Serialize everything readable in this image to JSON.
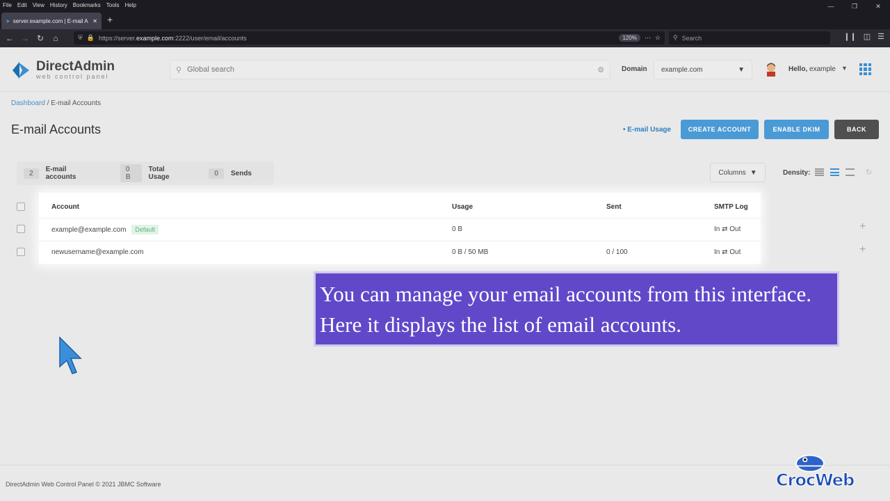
{
  "browser": {
    "menu": [
      "File",
      "Edit",
      "View",
      "History",
      "Bookmarks",
      "Tools",
      "Help"
    ],
    "tab_title": "server.example.com | E-mail A",
    "url_prefix": "https://server.",
    "url_domain": "example.com",
    "url_path": ":2222/user/email/accounts",
    "zoom": "120%",
    "search_placeholder": "Search"
  },
  "header": {
    "logo_name": "DirectAdmin",
    "logo_sub": "web control panel",
    "search_placeholder": "Global search",
    "domain_label": "Domain",
    "domain_value": "example.com",
    "hello_prefix": "Hello,",
    "hello_user": "example"
  },
  "breadcrumb": {
    "home": "Dashboard",
    "sep": " / ",
    "current": "E-mail Accounts"
  },
  "page": {
    "title": "E-mail Accounts",
    "usage_link": "• E-mail Usage",
    "create_label": "CREATE ACCOUNT",
    "dkim_label": "ENABLE DKIM",
    "back_label": "BACK"
  },
  "stats": [
    {
      "value": "2",
      "label": "E-mail accounts"
    },
    {
      "value": "0 B",
      "label": "Total Usage"
    },
    {
      "value": "0",
      "label": "Sends"
    }
  ],
  "toolbar": {
    "columns_label": "Columns",
    "density_label": "Density:"
  },
  "table": {
    "headers": {
      "account": "Account",
      "usage": "Usage",
      "sent": "Sent",
      "smtp": "SMTP Log"
    },
    "rows": [
      {
        "account": "example@example.com",
        "badge": "Default",
        "usage": "0 B",
        "sent": "",
        "smtp": "In ⇄ Out"
      },
      {
        "account": "newusername@example.com",
        "badge": "",
        "usage": "0 B / 50 MB",
        "sent": "0 / 100",
        "smtp": "In ⇄ Out"
      }
    ]
  },
  "caption": {
    "line1": "You can manage your email accounts from this interface.",
    "line2": "Here it displays the list of email accounts."
  },
  "footer": {
    "text": "DirectAdmin Web Control Panel © 2021 JBMC Software"
  },
  "watermark": {
    "text": "CrocWeb"
  },
  "colors": {
    "accent": "#4a9ad6",
    "caption_bg": "#6148c9",
    "back_btn": "#4f4f4f",
    "badge_green": "#5fb37a"
  }
}
